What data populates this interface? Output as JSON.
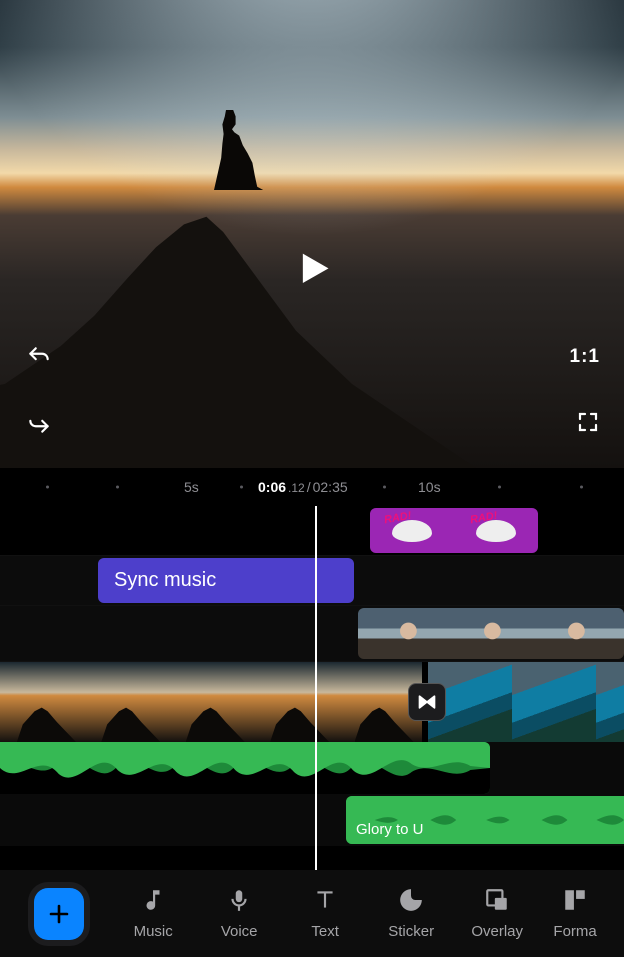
{
  "preview": {
    "aspect_ratio_label": "1:1"
  },
  "ruler": {
    "markers": {
      "5s": "5s",
      "10s": "10s"
    },
    "current_time_main": "0:06",
    "current_time_ms": ".12",
    "separator": " / ",
    "total_time": "02:35"
  },
  "tracks": {
    "sticker_label_1": "RAD!",
    "sticker_label_2": "RAD!",
    "sync_music_label": "Sync music",
    "song_name": "Glory to U"
  },
  "toolbar": {
    "music": "Music",
    "voice": "Voice",
    "text": "Text",
    "sticker": "Sticker",
    "overlay": "Overlay",
    "format": "Forma"
  }
}
